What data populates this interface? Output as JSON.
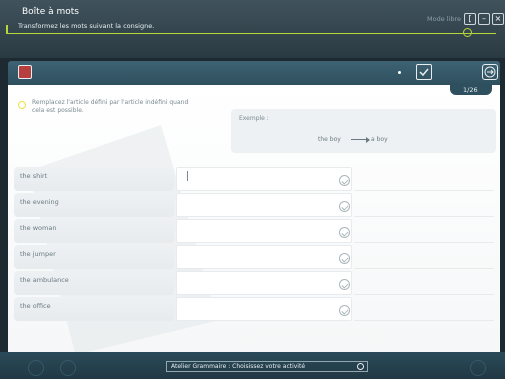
{
  "header": {
    "title": "Boîte à mots",
    "subtitle": "Transformez les mots suivant la consigne.",
    "mode_label": "Mode libre",
    "buttons": [
      "[",
      "–",
      "×"
    ]
  },
  "toolbar": {
    "counter": "1/26"
  },
  "instruction": {
    "text": "Remplacez l'article défini par l'article indéfini quand cela est possible."
  },
  "example": {
    "label": "Exemple :",
    "from": "the boy",
    "to": "a boy"
  },
  "rows": [
    {
      "label": "the shirt"
    },
    {
      "label": "the evening"
    },
    {
      "label": "the woman"
    },
    {
      "label": "the jumper"
    },
    {
      "label": "the ambulance"
    },
    {
      "label": "the office"
    }
  ],
  "footer": {
    "activity_select": "Atelier Grammaire : Choisissez votre activité"
  }
}
